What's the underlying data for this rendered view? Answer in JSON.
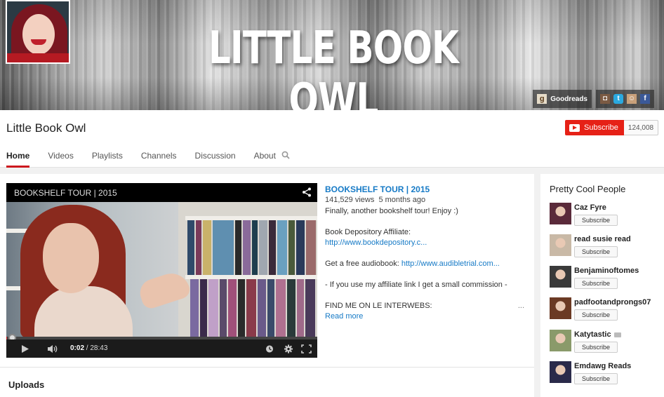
{
  "banner": {
    "title": "LITTLE BOOK OWL",
    "links": {
      "goodreads_label": "Goodreads",
      "goodreads_icon": "g",
      "social_icons": [
        "instagram-icon",
        "twitter-icon",
        "tumblr-icon",
        "facebook-icon"
      ]
    }
  },
  "header": {
    "channel_name": "Little Book Owl",
    "subscribe_label": "Subscribe",
    "subscriber_count": "124,008",
    "tabs": [
      {
        "label": "Home",
        "active": true
      },
      {
        "label": "Videos"
      },
      {
        "label": "Playlists"
      },
      {
        "label": "Channels"
      },
      {
        "label": "Discussion"
      },
      {
        "label": "About"
      }
    ]
  },
  "player": {
    "title": "BOOKSHELF TOUR | 2015",
    "time_current": "0:02",
    "time_total": "28:43",
    "progress_fraction": 0.0012,
    "accent": "#cc181e"
  },
  "description": {
    "title": "BOOKSHELF TOUR | 2015",
    "views": "141,529 views",
    "age": "5 months ago",
    "line1": "Finally, another bookshelf tour! Enjoy :)",
    "affiliate_label": "Book Depository Affiliate:",
    "affiliate_link": "http://www.bookdepository.c...",
    "audiobook_label": "Get a free audiobook: ",
    "audiobook_link": "http://www.audibletrial.com...",
    "commission": "- If you use my affiliate link I get a small commission -",
    "find_me": "FIND ME ON LE INTERWEBS:",
    "ellipsis": "...",
    "read_more": "Read more"
  },
  "uploads_heading": "Uploads",
  "sidebar": {
    "title": "Pretty Cool People",
    "subscribe_label": "Subscribe",
    "people": [
      {
        "name": "Caz Fyre",
        "color": "#5a2a3a"
      },
      {
        "name": "read susie read",
        "color": "#c9b9a6"
      },
      {
        "name": "Benjaminoftomes",
        "color": "#3a3a3a"
      },
      {
        "name": "padfootandprongs07",
        "color": "#6b3a24"
      },
      {
        "name": "Katytastic",
        "color": "#8a9a6a"
      },
      {
        "name": "Emdawg Reads",
        "color": "#2a2a4a"
      }
    ]
  }
}
